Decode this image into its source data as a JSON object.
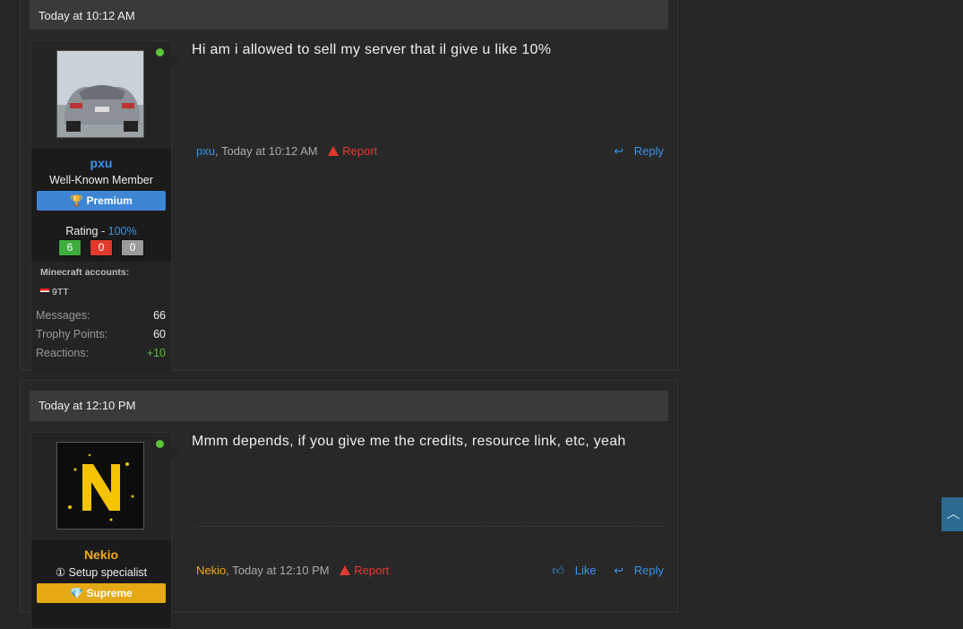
{
  "posts": [
    {
      "header_date": "Today at 10:12 AM",
      "username": "pxu",
      "user_title": "Well-Known Member",
      "banner": "Premium",
      "banner_icon": "trophy-icon",
      "rating_label": "Rating - ",
      "rating_pct": "100%",
      "rating_counts": [
        "6",
        "0",
        "0"
      ],
      "minecraft_label": "Minecraft accounts:",
      "minecraft_account": "9TT",
      "stats": [
        {
          "label": "Messages:",
          "value": "66"
        },
        {
          "label": "Trophy Points:",
          "value": "60"
        },
        {
          "label": "Reactions:",
          "value": "+10"
        }
      ],
      "message": "Hi am i allowed to sell my server that il give u like 10%",
      "footer_author": "pxu",
      "footer_date": ", Today at 10:12 AM",
      "report_label": "Report",
      "reply_label": "Reply"
    },
    {
      "header_date": "Today at 12:10 PM",
      "username": "Nekio",
      "user_title": "① Setup specialist",
      "banner": "Supreme",
      "banner_icon": "diamond-icon",
      "message": "Mmm depends, if you give me the credits, resource link, etc, yeah",
      "footer_author": "Nekio",
      "footer_date": ", Today at 12:10 PM",
      "report_label": "Report",
      "like_label": "Like",
      "reply_label": "Reply"
    }
  ],
  "colors": {
    "accent": "#3c93e8",
    "gold": "#f5a623",
    "report": "#e23a31",
    "online": "#5ec13c"
  }
}
